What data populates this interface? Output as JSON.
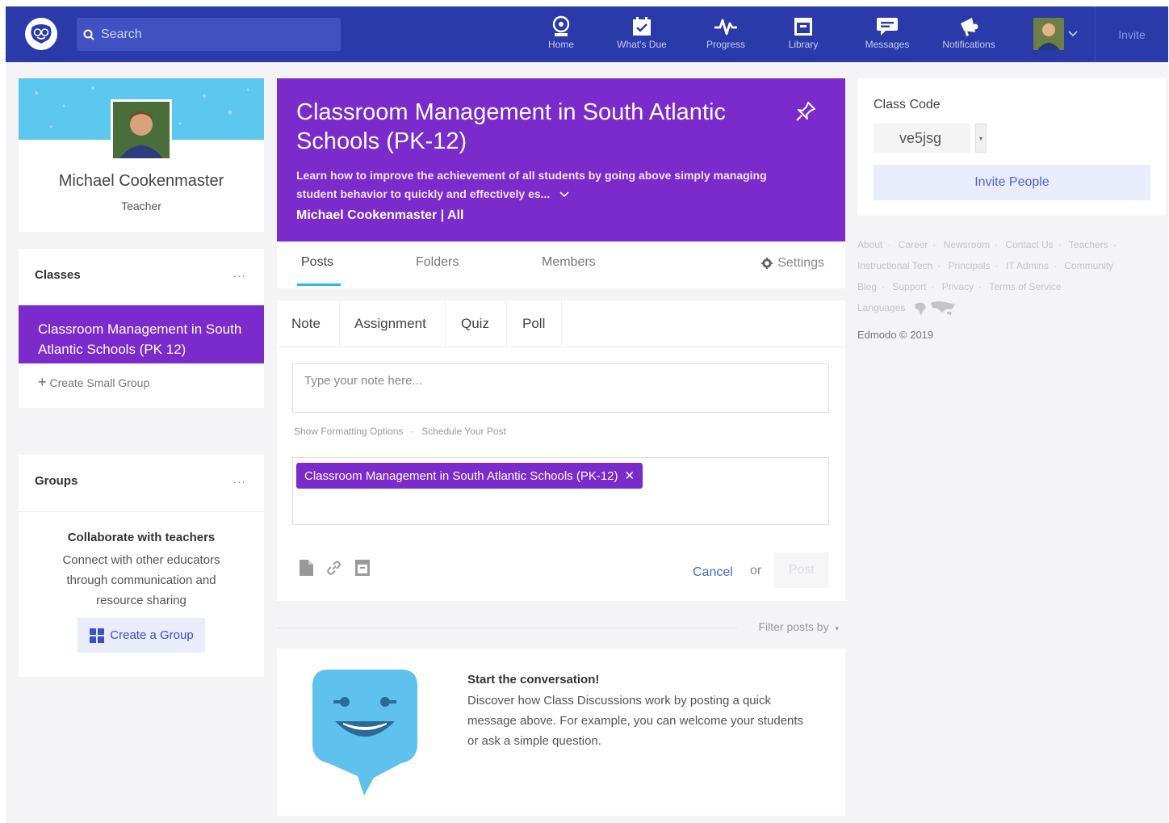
{
  "topbar": {
    "search_placeholder": "Search",
    "nav": [
      {
        "label": "Home",
        "icon": "home-icon"
      },
      {
        "label": "What's Due",
        "icon": "calendar-icon"
      },
      {
        "label": "Progress",
        "icon": "pulse-icon"
      },
      {
        "label": "Library",
        "icon": "library-icon"
      },
      {
        "label": "Messages",
        "icon": "messages-icon"
      },
      {
        "label": "Notifications",
        "icon": "megaphone-icon"
      }
    ],
    "invite": "Invite"
  },
  "profile": {
    "name": "Michael Cookenmaster",
    "role": "Teacher"
  },
  "classes": {
    "title": "Classes",
    "more": "...",
    "active_class": "Classroom Management in South Atlantic Schools (PK 12)",
    "create_small_group": "Create Small Group"
  },
  "groups": {
    "title": "Groups",
    "more": "...",
    "heading": "Collaborate with teachers",
    "description": "Connect with other educators through communication and resource sharing",
    "create_button": "Create a Group"
  },
  "course": {
    "title": "Classroom Management in South Atlantic Schools (PK-12)",
    "description": "Learn how to improve the achievement of all students by going above simply managing student behavior to quickly and effectively es...",
    "owner": "Michael Cookenmaster | All",
    "tabs": [
      "Posts",
      "Folders",
      "Members"
    ],
    "settings": "Settings"
  },
  "composer": {
    "tabs": [
      "Note",
      "Assignment",
      "Quiz",
      "Poll"
    ],
    "note_placeholder": "Type your note here...",
    "formatting": "Show Formatting Options",
    "schedule": "Schedule Your Post",
    "recipient_chip": "Classroom Management in South Atlantic Schools (PK-12)",
    "cancel": "Cancel",
    "or": "or",
    "post": "Post"
  },
  "feed": {
    "filter": "Filter posts by",
    "empty_title": "Start the conversation!",
    "empty_text": "Discover how Class Discussions work by posting a quick message above. For example, you can welcome your students or ask a simple question."
  },
  "right": {
    "class_code_label": "Class Code",
    "class_code": "ve5jsg",
    "invite_people": "Invite People",
    "footer_links": [
      "About",
      "Career",
      "Newsroom",
      "Contact Us",
      "Teachers",
      "Instructional Tech",
      "Principals",
      "IT Admins",
      "Community",
      "Blog",
      "Support",
      "Privacy",
      "Terms of Service",
      "Languages"
    ],
    "copyright": "Edmodo © 2019"
  },
  "colors": {
    "topbar": "#2a3aa9",
    "class_purple": "#7b2bcc",
    "tab_underline": "#2fb7e6",
    "link_blue": "#3a6fd0"
  }
}
